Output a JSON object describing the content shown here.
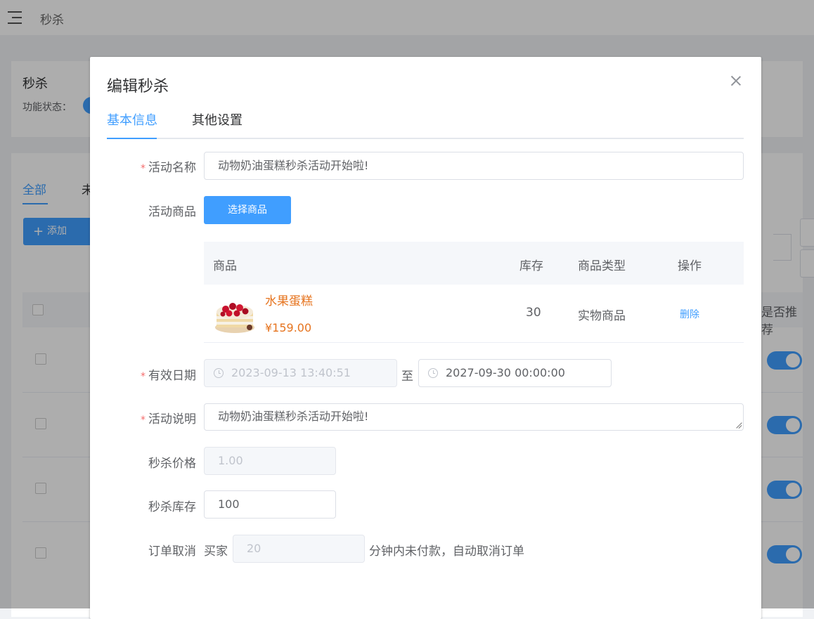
{
  "topbar": {
    "title": "秒杀"
  },
  "card": {
    "title": "秒杀",
    "status_label": "功能状态："
  },
  "list": {
    "tab_all": "全部",
    "tab_other": "未",
    "add_button": "添加",
    "col_recommend": "是否推荐"
  },
  "dialog": {
    "title": "编辑秒杀",
    "tabs": [
      "基本信息",
      "其他设置"
    ],
    "labels": {
      "name": "活动名称",
      "goods": "活动商品",
      "date": "有效日期",
      "desc": "活动说明",
      "price": "秒杀价格",
      "stock": "秒杀库存",
      "cancel": "订单取消"
    },
    "required_mark": "*",
    "name_value": "动物奶油蛋糕秒杀活动开始啦!",
    "select_goods_button": "选择商品",
    "goods_table": {
      "headers": [
        "商品",
        "库存",
        "商品类型",
        "操作"
      ],
      "rows": [
        {
          "name": "水果蛋糕",
          "price": "¥159.00",
          "stock": "30",
          "type": "实物商品",
          "action": "删除"
        }
      ]
    },
    "date_start": "2023-09-13 13:40:51",
    "date_separator": "至",
    "date_end": "2027-09-30 00:00:00",
    "desc_value": "动物奶油蛋糕秒杀活动开始啦!",
    "price_value": "1.00",
    "stock_value": "100",
    "cancel_prefix": "买家",
    "cancel_minutes": "20",
    "cancel_suffix": "分钟内未付款，自动取消订单"
  },
  "colors": {
    "primary": "#409eff",
    "danger": "#f56c6c",
    "price": "#e6741f"
  }
}
